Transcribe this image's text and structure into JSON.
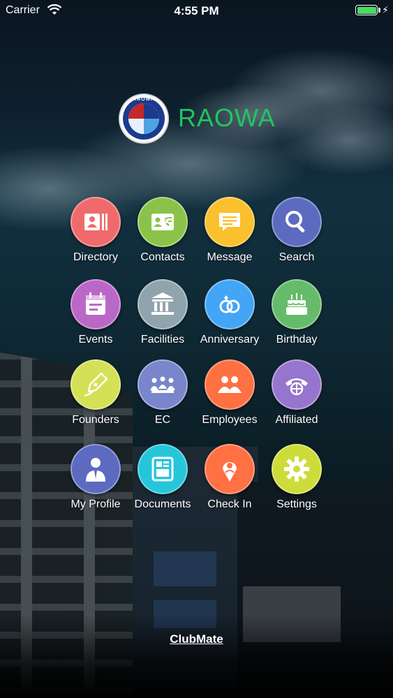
{
  "status_bar": {
    "carrier": "Carrier",
    "time": "4:55 PM"
  },
  "header": {
    "logo_text": "RAOWA",
    "brand": "RAOWA",
    "brand_color": "#22c55e"
  },
  "menu": [
    {
      "label": "Directory",
      "icon": "directory-card-icon",
      "color": "#ef6b6b"
    },
    {
      "label": "Contacts",
      "icon": "contact-card-icon",
      "color": "#8bc34a"
    },
    {
      "label": "Message",
      "icon": "message-bubble-icon",
      "color": "#fbc02d"
    },
    {
      "label": "Search",
      "icon": "search-icon",
      "color": "#5c6bc0"
    },
    {
      "label": "Events",
      "icon": "calendar-icon",
      "color": "#ba68c8"
    },
    {
      "label": "Facilities",
      "icon": "bank-building-icon",
      "color": "#90a4ae"
    },
    {
      "label": "Anniversary",
      "icon": "rings-icon",
      "color": "#42a5f5"
    },
    {
      "label": "Birthday",
      "icon": "cake-icon",
      "color": "#66bb6a"
    },
    {
      "label": "Founders",
      "icon": "pen-nib-icon",
      "color": "#d4e157"
    },
    {
      "label": "EC",
      "icon": "meeting-group-icon",
      "color": "#7986cb"
    },
    {
      "label": "Employees",
      "icon": "people-icon",
      "color": "#ff7043"
    },
    {
      "label": "Affiliated",
      "icon": "globe-phone-icon",
      "color": "#9575cd"
    },
    {
      "label": "My Profile",
      "icon": "profile-person-icon",
      "color": "#5c6bc0"
    },
    {
      "label": "Documents",
      "icon": "document-grid-icon",
      "color": "#26c6da"
    },
    {
      "label": "Check In",
      "icon": "location-pin-icon",
      "color": "#ff7043"
    },
    {
      "label": "Settings",
      "icon": "gear-icon",
      "color": "#cddc39"
    }
  ],
  "footer": {
    "label": "ClubMate"
  }
}
